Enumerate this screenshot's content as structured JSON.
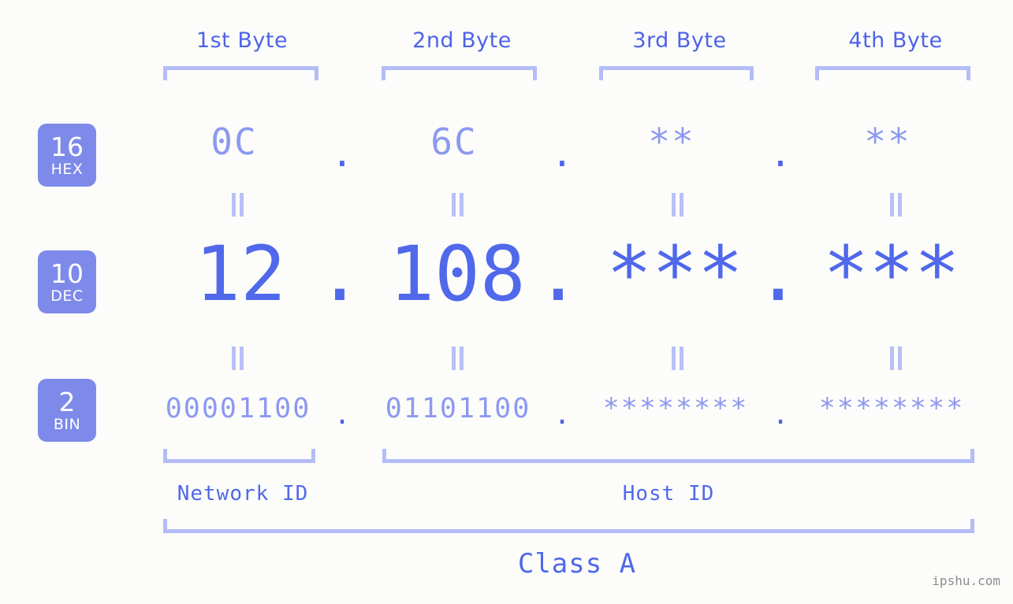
{
  "background_color": "#fcfdfa",
  "accent_color": "#5068ea",
  "accent_light_color": "#8d99ef",
  "bracket_color": "#b4bdf7",
  "badge_color": "#7d8aea",
  "header": {
    "byte_labels": [
      "1st Byte",
      "2nd Byte",
      "3rd Byte",
      "4th Byte"
    ]
  },
  "rows": [
    {
      "base_number": "16",
      "base_abbr": "HEX",
      "values": [
        "0C",
        "6C",
        "**",
        "**"
      ],
      "separator": "."
    },
    {
      "base_number": "10",
      "base_abbr": "DEC",
      "values": [
        "12",
        "108",
        "***",
        "***"
      ],
      "separator": "."
    },
    {
      "base_number": "2",
      "base_abbr": "BIN",
      "values": [
        "00001100",
        "01101100",
        "********",
        "********"
      ],
      "separator": "."
    }
  ],
  "equal_mark": "=",
  "footer": {
    "network_id_label": "Network ID",
    "host_id_label": "Host ID",
    "class_label": "Class A"
  },
  "watermark": "ipshu.com"
}
